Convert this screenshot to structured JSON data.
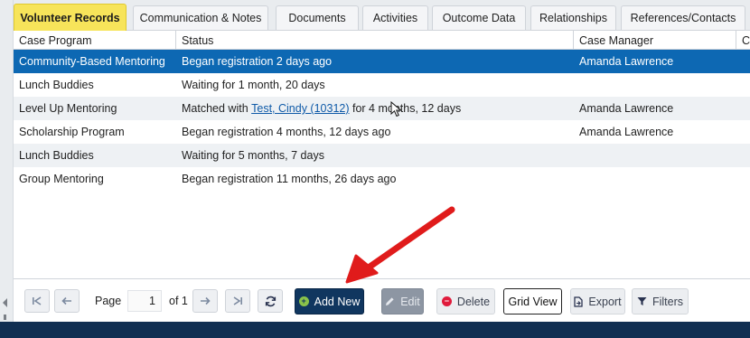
{
  "tabs": [
    {
      "label": "Volunteer Records",
      "active": true
    },
    {
      "label": "Communication & Notes"
    },
    {
      "label": "Documents"
    },
    {
      "label": "Activities"
    },
    {
      "label": "Outcome Data"
    },
    {
      "label": "Relationships"
    },
    {
      "label": "References/Contacts"
    }
  ],
  "grid": {
    "columns": [
      "Case Program",
      "Status",
      "Case Manager",
      "C"
    ],
    "rows": [
      {
        "program": "Community-Based Mentoring",
        "status": "Began registration 2 days ago",
        "manager": "Amanda Lawrence",
        "selected": true
      },
      {
        "program": "Lunch Buddies",
        "status": "Waiting for 1 month, 20 days",
        "manager": ""
      },
      {
        "program": "Level Up Mentoring",
        "status_prefix": "Matched with ",
        "status_link": "Test, Cindy (10312)",
        "status_suffix": " for 4 months, 12 days",
        "manager": "Amanda Lawrence"
      },
      {
        "program": "Scholarship Program",
        "status": "Began registration 4 months, 12 days ago",
        "manager": "Amanda Lawrence"
      },
      {
        "program": "Lunch Buddies",
        "status": "Waiting for 5 months, 7 days",
        "manager": ""
      },
      {
        "program": "Group Mentoring",
        "status": "Began registration 11 months, 26 days ago",
        "manager": ""
      }
    ]
  },
  "pager": {
    "page_label": "Page",
    "current_page": "1",
    "of_label": "of 1"
  },
  "actions": {
    "add_new": "Add New",
    "edit": "Edit",
    "delete": "Delete",
    "grid_view": "Grid View",
    "export": "Export",
    "filters": "Filters"
  },
  "colors": {
    "active_tab": "#f7e45a",
    "selected_row": "#0d68b3",
    "primary_button": "#10365f",
    "annotation_arrow": "#e01b1b"
  }
}
